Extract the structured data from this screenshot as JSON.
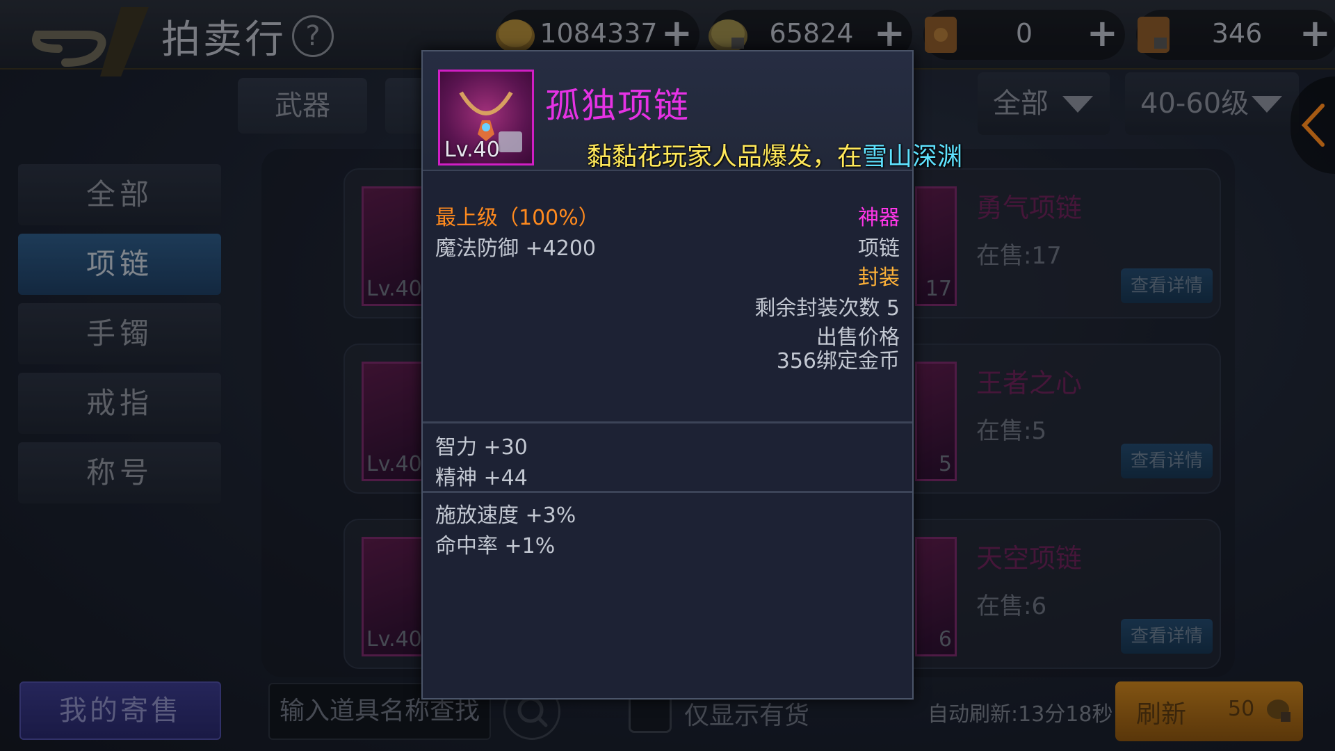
{
  "header": {
    "title": "拍卖行",
    "help": "?"
  },
  "currencies": [
    {
      "value": "1084337",
      "plus": "+",
      "icon": "gold-coin-icon"
    },
    {
      "value": "65824",
      "plus": "+",
      "icon": "bound-coin-icon"
    },
    {
      "value": "0",
      "plus": "+",
      "icon": "scroll-icon"
    },
    {
      "value": "346",
      "plus": "+",
      "icon": "locked-scroll-icon"
    }
  ],
  "tabs": {
    "weapon": "武器",
    "filter_all": "全部",
    "filter_level": "40-60级"
  },
  "sidebar": {
    "items": [
      "全部",
      "项链",
      "手镯",
      "戒指",
      "称号"
    ]
  },
  "listing": [
    {
      "lv": "Lv.40",
      "count": "17",
      "name": "勇气项链",
      "on_sale": "在售:17",
      "detail": "查看详情"
    },
    {
      "lv": "Lv.40",
      "count": "5",
      "name": "王者之心",
      "on_sale": "在售:5",
      "detail": "查看详情"
    },
    {
      "lv": "Lv.40",
      "count": "6",
      "name": "天空项链",
      "on_sale": "在售:6",
      "detail": "查看详情"
    }
  ],
  "bottom": {
    "my_consign": "我的寄售",
    "search_placeholder": "输入道具名称查找",
    "stock_only": "仅显示有货",
    "auto_refresh": "自动刷新:13分18秒",
    "refresh": "刷新",
    "refresh_cost": "50"
  },
  "tooltip": {
    "item_name": "孤独项链",
    "item_level": "Lv.40",
    "marquee_text": "黏黏花玩家人品爆发，在",
    "marquee_location": "雪山深渊",
    "quality": "最上级（100%）",
    "rarity": "神器",
    "main_stat": "魔法防御 +4200",
    "slot": "项链",
    "sealable": "封装",
    "seal_remaining": "剩余封装次数 5",
    "sell_price_label": "出售价格",
    "sell_price_value": "356绑定金币",
    "stats": [
      "智力 +30",
      "精神 +44"
    ],
    "extra_stats": [
      "施放速度 +3%",
      "命中率 +1%"
    ]
  },
  "colors": {
    "rarity_magenta": "#e632e4",
    "quality_orange": "#ff8a1e",
    "seal_gold": "#ffb238",
    "marquee_yellow": "#ffe85a",
    "marquee_cyan": "#5fe2ff"
  }
}
